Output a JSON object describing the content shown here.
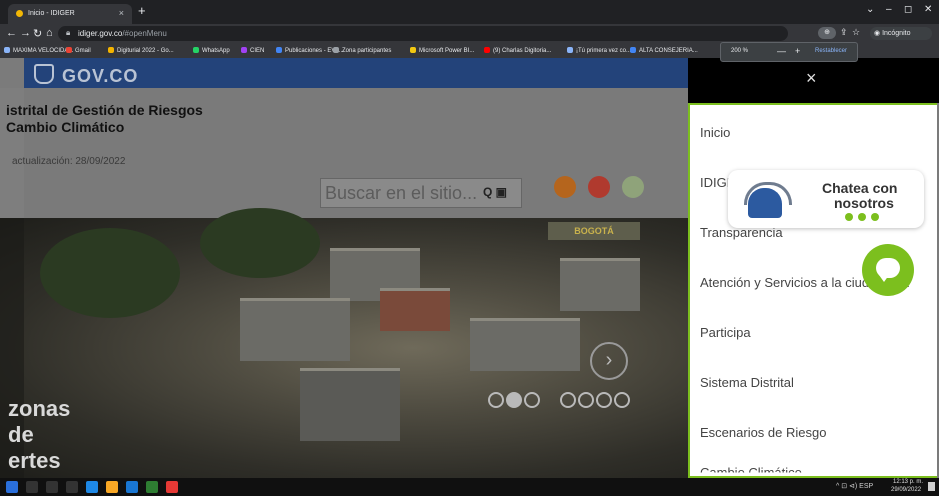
{
  "browser": {
    "tab_title": "Inicio - IDIGER",
    "tab_close": "×",
    "new_tab": "+",
    "url_host": "idiger.gov.co",
    "url_path": "/#openMenu",
    "incognito_label": "Incógnito",
    "zoom_popup": {
      "level": "200 %",
      "minus": "—",
      "plus": "+",
      "reset": "Restablecer"
    },
    "bookmarks": [
      {
        "label": "MAXIMA VELOCIDA...",
        "color": "#8ab4f8"
      },
      {
        "label": "Gmail",
        "color": "#ea4335"
      },
      {
        "label": "Digiturial 2022 - Go...",
        "color": "#f4b400"
      },
      {
        "label": "WhatsApp",
        "color": "#25d366"
      },
      {
        "label": "CIEN",
        "color": "#a142f4"
      },
      {
        "label": "Publicaciones - EVA...",
        "color": "#4285f4"
      },
      {
        "label": "Zona participantes",
        "color": "#9aa0a6"
      },
      {
        "label": "Microsoft Power BI...",
        "color": "#f2c811"
      },
      {
        "label": "(9) Charlas Digitoria...",
        "color": "#ff0000"
      },
      {
        "label": "¡Tú primera vez co...",
        "color": "#8ab4f8"
      },
      {
        "label": "ALTA CONSEJERIA...",
        "color": "#4285f4"
      }
    ]
  },
  "site": {
    "gov_logo": "GOV.CO",
    "title_line1": "istrital de Gestión de Riesgos",
    "title_line2": "Cambio Climático",
    "updated": "actualización: 28/09/2022",
    "search_placeholder": "Buscar en el sitio...",
    "hero_line1": "zonas",
    "hero_line2": "de",
    "hero_line3": "ertes",
    "bogota_label": "BOGOTÁ",
    "next_arrow": "›"
  },
  "menu": {
    "close": "×",
    "items": [
      "Inicio",
      "IDIGER",
      "Transparencia",
      "Atención y Servicios a la ciudadanía",
      "Participa",
      "Sistema Distrital",
      "Escenarios de Riesgo",
      "Cambio Climático"
    ]
  },
  "chat": {
    "line1": "Chatea con",
    "line2": "nosotros"
  },
  "taskbar": {
    "tray": "^  ⊡  ⊲)  ESP",
    "time": "12:13 p. m.",
    "date": "29/09/2022"
  },
  "colors": {
    "accent_green": "#7cbf1e",
    "gov_blue": "#23437a"
  }
}
